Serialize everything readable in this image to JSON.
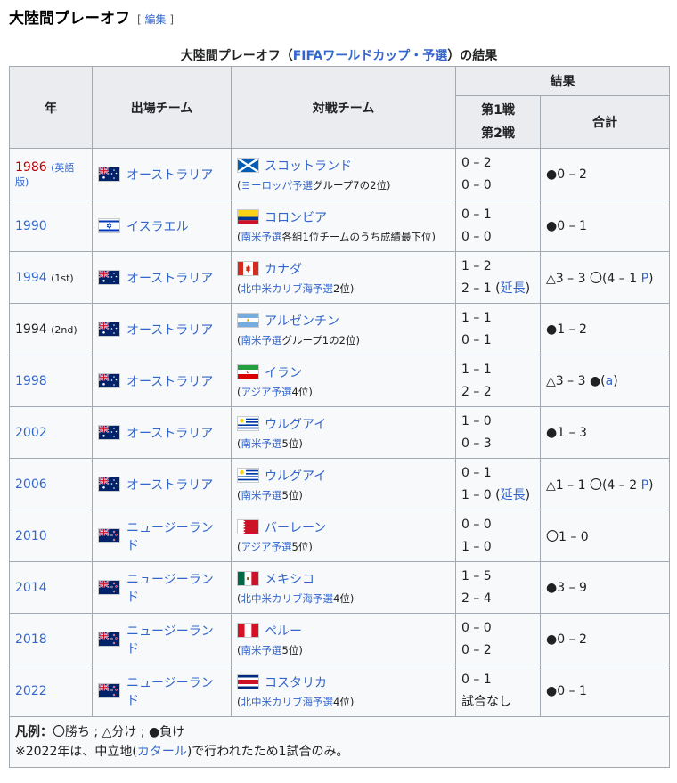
{
  "heading": {
    "title": "大陸間プレーオフ",
    "edit_open": "[",
    "edit_label": "編集",
    "edit_close": "]"
  },
  "caption": {
    "prefix": "大陸間プレーオフ（",
    "link": "FIFAワールドカップ・予選",
    "suffix": "）の結果"
  },
  "headers": {
    "year": "年",
    "team": "出場チーム",
    "opponent": "対戦チーム",
    "result": "結果",
    "leg1": "第1戦",
    "leg2": "第2戦",
    "total": "合計"
  },
  "colors": {
    "link": "#3366cc",
    "redlink": "#ba0000",
    "header_bg": "#eaecf0",
    "border": "#a2a9b1"
  },
  "rows": [
    {
      "year": "1986",
      "year_note": "(英語版)",
      "team": "オーストラリア",
      "team_flag": "flag-australia-icon",
      "opp": "スコットランド",
      "opp_flag": "flag-scotland-icon",
      "opp_note_pre": "(",
      "opp_note_link": "ヨーロッパ予選",
      "opp_note_post": "グループ7の2位)",
      "leg1": "0 – 2",
      "leg2": "0 – 0",
      "leg2_link": "",
      "leg2_close": "",
      "mark": "●",
      "total": "0 – 2",
      "total_link": "",
      "total_close": ""
    },
    {
      "year": "1990",
      "year_note": "",
      "team": "イスラエル",
      "team_flag": "flag-israel-icon",
      "opp": "コロンビア",
      "opp_flag": "flag-colombia-icon",
      "opp_note_pre": "(",
      "opp_note_link": "南米予選",
      "opp_note_post": "各組1位チームのうち成績最下位)",
      "leg1": "0 – 1",
      "leg2": "0 – 0",
      "leg2_link": "",
      "leg2_close": "",
      "mark": "●",
      "total": "0 – 1",
      "total_link": "",
      "total_close": ""
    },
    {
      "year": "1994",
      "year_note": "(1st)",
      "team": "オーストラリア",
      "team_flag": "flag-australia-icon",
      "opp": "カナダ",
      "opp_flag": "flag-canada-icon",
      "opp_note_pre": "(",
      "opp_note_link": "北中米カリブ海予選",
      "opp_note_post": "2位)",
      "leg1": "1 – 2",
      "leg2": "2 – 1 (",
      "leg2_link": "延長",
      "leg2_close": ")",
      "mark": "△",
      "total": "3 – 3 〇(4 – 1 ",
      "total_link": "P",
      "total_close": ")"
    },
    {
      "year": "1994",
      "year_note": "(2nd)",
      "team": "オーストラリア",
      "team_flag": "flag-australia-icon",
      "opp": "アルゼンチン",
      "opp_flag": "flag-argentina-icon",
      "opp_note_pre": "(",
      "opp_note_link": "南米予選",
      "opp_note_post": "グループ1の2位)",
      "leg1": "1 – 1",
      "leg2": "0 – 1",
      "leg2_link": "",
      "leg2_close": "",
      "mark": "●",
      "total": "1 – 2",
      "total_link": "",
      "total_close": ""
    },
    {
      "year": "1998",
      "year_note": "",
      "team": "オーストラリア",
      "team_flag": "flag-australia-icon",
      "opp": "イラン",
      "opp_flag": "flag-iran-icon",
      "opp_note_pre": "(",
      "opp_note_link": "アジア予選",
      "opp_note_post": "4位)",
      "leg1": "1 – 1",
      "leg2": "2 – 2",
      "leg2_link": "",
      "leg2_close": "",
      "mark": "△",
      "total": "3 – 3 ●(",
      "total_link": "a",
      "total_close": ")"
    },
    {
      "year": "2002",
      "year_note": "",
      "team": "オーストラリア",
      "team_flag": "flag-australia-icon",
      "opp": "ウルグアイ",
      "opp_flag": "flag-uruguay-icon",
      "opp_note_pre": "(",
      "opp_note_link": "南米予選",
      "opp_note_post": "5位)",
      "leg1": "1 – 0",
      "leg2": "0 – 3",
      "leg2_link": "",
      "leg2_close": "",
      "mark": "●",
      "total": "1 – 3",
      "total_link": "",
      "total_close": ""
    },
    {
      "year": "2006",
      "year_note": "",
      "team": "オーストラリア",
      "team_flag": "flag-australia-icon",
      "opp": "ウルグアイ",
      "opp_flag": "flag-uruguay-icon",
      "opp_note_pre": "(",
      "opp_note_link": "南米予選",
      "opp_note_post": "5位)",
      "leg1": "0 – 1",
      "leg2": "1 – 0 (",
      "leg2_link": "延長",
      "leg2_close": ")",
      "mark": "△",
      "total": "1 – 1 〇(4 – 2 ",
      "total_link": "P",
      "total_close": ")"
    },
    {
      "year": "2010",
      "year_note": "",
      "team": "ニュージーランド",
      "team_flag": "flag-new-zealand-icon",
      "opp": "バーレーン",
      "opp_flag": "flag-bahrain-icon",
      "opp_note_pre": "(",
      "opp_note_link": "アジア予選",
      "opp_note_post": "5位)",
      "leg1": "0 – 0",
      "leg2": "1 – 0",
      "leg2_link": "",
      "leg2_close": "",
      "mark": "〇",
      "total": "1 – 0",
      "total_link": "",
      "total_close": ""
    },
    {
      "year": "2014",
      "year_note": "",
      "team": "ニュージーランド",
      "team_flag": "flag-new-zealand-icon",
      "opp": "メキシコ",
      "opp_flag": "flag-mexico-icon",
      "opp_note_pre": "(",
      "opp_note_link": "北中米カリブ海予選",
      "opp_note_post": "4位)",
      "leg1": "1 – 5",
      "leg2": "2 – 4",
      "leg2_link": "",
      "leg2_close": "",
      "mark": "●",
      "total": "3 – 9",
      "total_link": "",
      "total_close": ""
    },
    {
      "year": "2018",
      "year_note": "",
      "team": "ニュージーランド",
      "team_flag": "flag-new-zealand-icon",
      "opp": "ペルー",
      "opp_flag": "flag-peru-icon",
      "opp_note_pre": "(",
      "opp_note_link": "南米予選",
      "opp_note_post": "5位)",
      "leg1": "0 – 0",
      "leg2": "0 – 2",
      "leg2_link": "",
      "leg2_close": "",
      "mark": "●",
      "total": "0 – 2",
      "total_link": "",
      "total_close": ""
    },
    {
      "year": "2022",
      "year_note": "",
      "team": "ニュージーランド",
      "team_flag": "flag-new-zealand-icon",
      "opp": "コスタリカ",
      "opp_flag": "flag-costa-rica-icon",
      "opp_note_pre": "(",
      "opp_note_link": "北中米カリブ海予選",
      "opp_note_post": "4位)",
      "leg1": "0 – 1",
      "leg2": "試合なし",
      "leg2_link": "",
      "leg2_close": "",
      "mark": "●",
      "total": "0 – 1",
      "total_link": "",
      "total_close": ""
    }
  ],
  "legend": {
    "label": "凡例：",
    "text": "〇勝ち ; △分け ; ●負け",
    "note_pre": "※2022年は、中立地(",
    "note_link": "カタール",
    "note_post": ")で行われたため1試合のみ。"
  }
}
